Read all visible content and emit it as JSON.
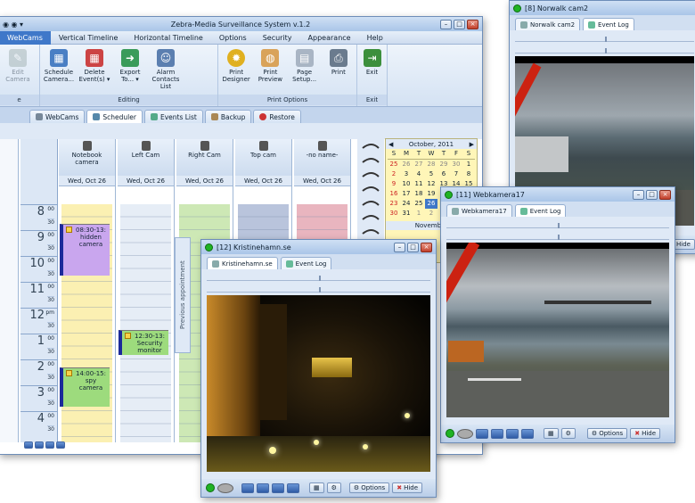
{
  "main": {
    "title": "Zebra-Media Surveillance System v.1.2",
    "menu": [
      "WebCams",
      "Vertical Timeline",
      "Horizontal Timeline",
      "Options",
      "Security",
      "Appearance",
      "Help"
    ],
    "ribbon": {
      "groups": [
        {
          "label": "",
          "buttons": [
            {
              "label": "Edit Camera"
            }
          ]
        },
        {
          "label": "Editing",
          "buttons": [
            {
              "label": "Schedule Camera..."
            },
            {
              "label": "Delete Event(s) ▾"
            },
            {
              "label": "Export To... ▾"
            },
            {
              "label": "Alarm Contacts List"
            }
          ]
        },
        {
          "label": "Print Options",
          "buttons": [
            {
              "label": "Print Designer"
            },
            {
              "label": "Print Preview"
            },
            {
              "label": "Page Setup..."
            },
            {
              "label": "Print"
            }
          ]
        },
        {
          "label": "Exit",
          "buttons": [
            {
              "label": "Exit"
            }
          ]
        }
      ]
    },
    "subtabs": [
      "WebCams",
      "Scheduler",
      "Events List",
      "Backup",
      "Restore"
    ],
    "cameras": [
      {
        "name": "Notebook camera",
        "date": "Wed, Oct 26"
      },
      {
        "name": "Left Cam",
        "date": "Wed, Oct 26"
      },
      {
        "name": "Right Cam",
        "date": "Wed, Oct 26"
      },
      {
        "name": "Top cam",
        "date": "Wed, Oct 26"
      },
      {
        "name": "-no name-",
        "date": "Wed, Oct 26"
      }
    ],
    "hours": [
      {
        "h": "8",
        "s": "00"
      },
      {
        "h": "9",
        "s": "00"
      },
      {
        "h": "10",
        "s": "00"
      },
      {
        "h": "11",
        "s": "00"
      },
      {
        "h": "12",
        "s": "pm"
      },
      {
        "h": "1",
        "s": "00"
      },
      {
        "h": "2",
        "s": "00"
      },
      {
        "h": "3",
        "s": "00"
      },
      {
        "h": "4",
        "s": "00"
      }
    ],
    "half": "30",
    "events": [
      {
        "text": "08:30-13: hidden camera"
      },
      {
        "text": "12:30-13: Security monitor"
      },
      {
        "text": "14:00-15: spy camera"
      }
    ],
    "side_label": "Previous appointment",
    "calendar": {
      "month1": "October, 2011",
      "month2": "November",
      "days": [
        "S",
        "M",
        "T",
        "W",
        "T",
        "F",
        "S"
      ],
      "rows": [
        [
          "25",
          "26",
          "27",
          "28",
          "29",
          "30",
          "1"
        ],
        [
          "2",
          "3",
          "4",
          "5",
          "6",
          "7",
          "8"
        ],
        [
          "9",
          "10",
          "11",
          "12",
          "13",
          "14",
          "15"
        ],
        [
          "16",
          "17",
          "18",
          "19",
          "20",
          "21",
          "22"
        ],
        [
          "23",
          "24",
          "25",
          "26",
          "27",
          "28",
          "29"
        ],
        [
          "30",
          "31",
          "1",
          "2",
          "3",
          "4",
          "5"
        ]
      ]
    }
  },
  "cam_windows": {
    "kristinehamn": {
      "title": "[12] Kristinehamn.se",
      "tab": "Kristinehamn.se",
      "log": "Event Log",
      "options": "Options",
      "hide": "Hide"
    },
    "webkamera17": {
      "title": "[11] Webkamera17",
      "tab": "Webkamera17",
      "log": "Event Log",
      "options": "Options",
      "hide": "Hide"
    },
    "norwalk": {
      "title": "[8] Norwalk cam2",
      "tab": "Norwalk cam2",
      "log": "Event Log",
      "hide": "Hide"
    }
  },
  "colors": {
    "accent": "#3f78c9",
    "title_bar": "#a9c5e8",
    "event_purple": "#c9a6ee",
    "event_green": "#9ddb7d",
    "cal_yellow": "#fff6b8"
  }
}
